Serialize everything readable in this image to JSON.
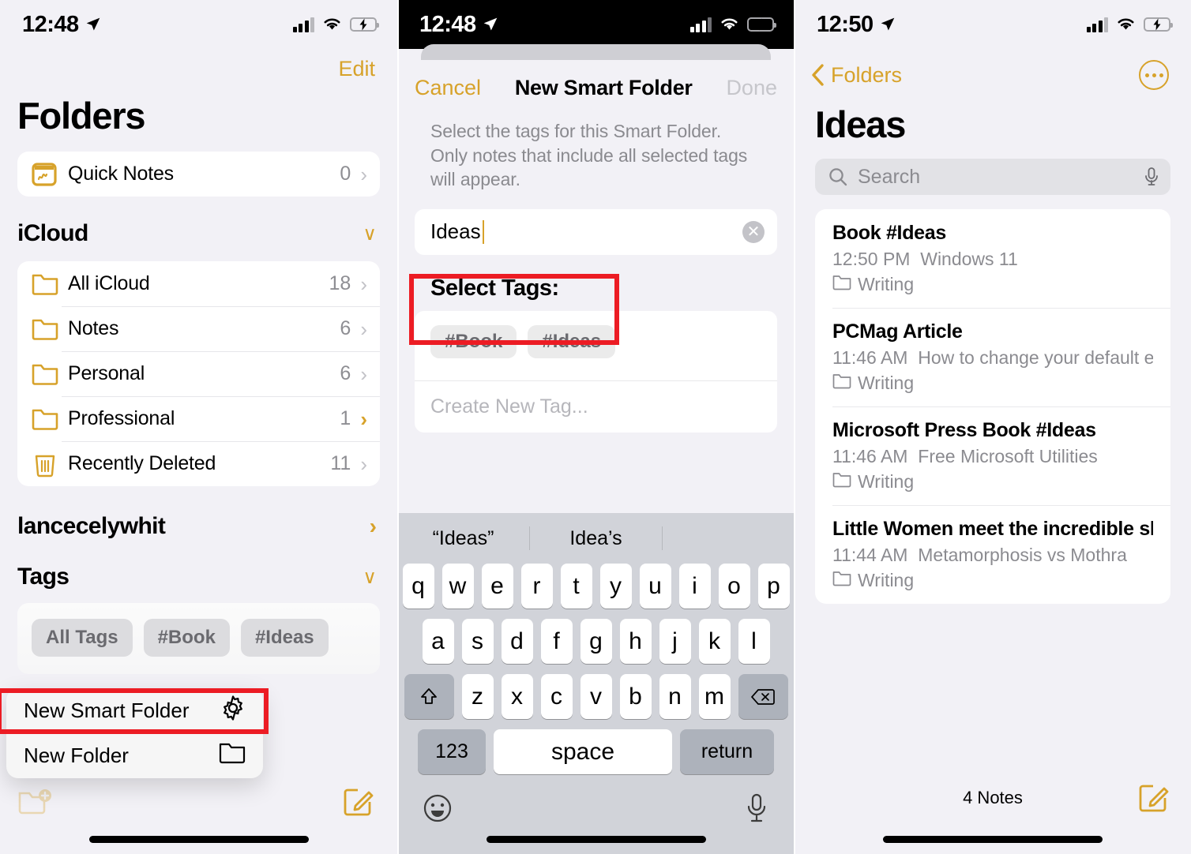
{
  "panel1": {
    "status": {
      "time": "12:48",
      "location_icon": "location-arrow-icon",
      "signal_icon": "cellular-bars-icon",
      "wifi_icon": "wifi-icon",
      "battery_icon": "battery-charging-icon"
    },
    "edit_label": "Edit",
    "title": "Folders",
    "quick_notes": {
      "label": "Quick Notes",
      "count": "0",
      "icon": "quick-note-icon",
      "chevron": "›"
    },
    "icloud_section": {
      "label": "iCloud",
      "chevron": "∨"
    },
    "icloud_items": [
      {
        "label": "All iCloud",
        "count": "18",
        "icon": "folder-icon",
        "accent": false
      },
      {
        "label": "Notes",
        "count": "6",
        "icon": "folder-icon",
        "accent": false
      },
      {
        "label": "Personal",
        "count": "6",
        "icon": "folder-icon",
        "accent": false
      },
      {
        "label": "Professional",
        "count": "1",
        "icon": "folder-icon",
        "accent": true
      },
      {
        "label": "Recently Deleted",
        "count": "11",
        "icon": "trash-icon",
        "accent": false
      }
    ],
    "account": {
      "label": "lancecelywhit",
      "chevron": "›"
    },
    "tags_section": {
      "label": "Tags",
      "chevron": "∨"
    },
    "tag_chips": [
      "All Tags",
      "#Book",
      "#Ideas"
    ],
    "context_menu": [
      {
        "label": "New Smart Folder",
        "icon": "gear-icon"
      },
      {
        "label": "New Folder",
        "icon": "folder-outline-icon"
      }
    ],
    "toolbar": {
      "new_folder_icon": "new-folder-icon",
      "compose_icon": "compose-icon"
    }
  },
  "panel2": {
    "status": {
      "time": "12:48"
    },
    "nav": {
      "cancel": "Cancel",
      "title": "New Smart Folder",
      "done": "Done"
    },
    "description": "Select the tags for this Smart Folder. Only notes that include all selected tags will appear.",
    "name_field": {
      "value": "Ideas",
      "clear_icon": "clear-circle-icon"
    },
    "select_tags_heading": "Select Tags:",
    "available_tags": [
      "#Book",
      "#Ideas"
    ],
    "create_tag_placeholder": "Create New Tag...",
    "keyboard": {
      "suggestions": [
        "“Ideas”",
        "Idea’s"
      ],
      "row1": [
        "q",
        "w",
        "e",
        "r",
        "t",
        "y",
        "u",
        "i",
        "o",
        "p"
      ],
      "row2": [
        "a",
        "s",
        "d",
        "f",
        "g",
        "h",
        "j",
        "k",
        "l"
      ],
      "row3": [
        "z",
        "x",
        "c",
        "v",
        "b",
        "n",
        "m"
      ],
      "shift_icon": "shift-icon",
      "backspace_icon": "backspace-icon",
      "numbers_key": "123",
      "space_key": "space",
      "return_key": "return",
      "emoji_icon": "emoji-icon",
      "mic_icon": "microphone-icon"
    }
  },
  "panel3": {
    "status": {
      "time": "12:50"
    },
    "back_label": "Folders",
    "more_icon": "more-ellipsis-icon",
    "title": "Ideas",
    "search": {
      "placeholder": "Search",
      "icon": "search-icon",
      "mic_icon": "microphone-icon"
    },
    "notes": [
      {
        "title": "Book #Ideas",
        "time": "12:50 PM",
        "preview": "Windows 11",
        "folder": "Writing"
      },
      {
        "title": "PCMag Article",
        "time": "11:46 AM",
        "preview": "How to change your default email…",
        "folder": "Writing"
      },
      {
        "title": "Microsoft Press Book #Ideas",
        "time": "11:46 AM",
        "preview": "Free Microsoft Utilities",
        "folder": "Writing"
      },
      {
        "title": "Little Women meet the incredible shri…",
        "time": "11:44 AM",
        "preview": "Metamorphosis vs Mothra",
        "folder": "Writing"
      }
    ],
    "notes_count": "4 Notes",
    "compose_icon": "compose-icon"
  },
  "annotations": {
    "box1_name": "highlight-new-smart-folder",
    "box2_name": "highlight-available-tags"
  },
  "colors": {
    "accent": "#d7a22a",
    "highlight": "#ec1c24",
    "bg": "#f2f1f6"
  }
}
